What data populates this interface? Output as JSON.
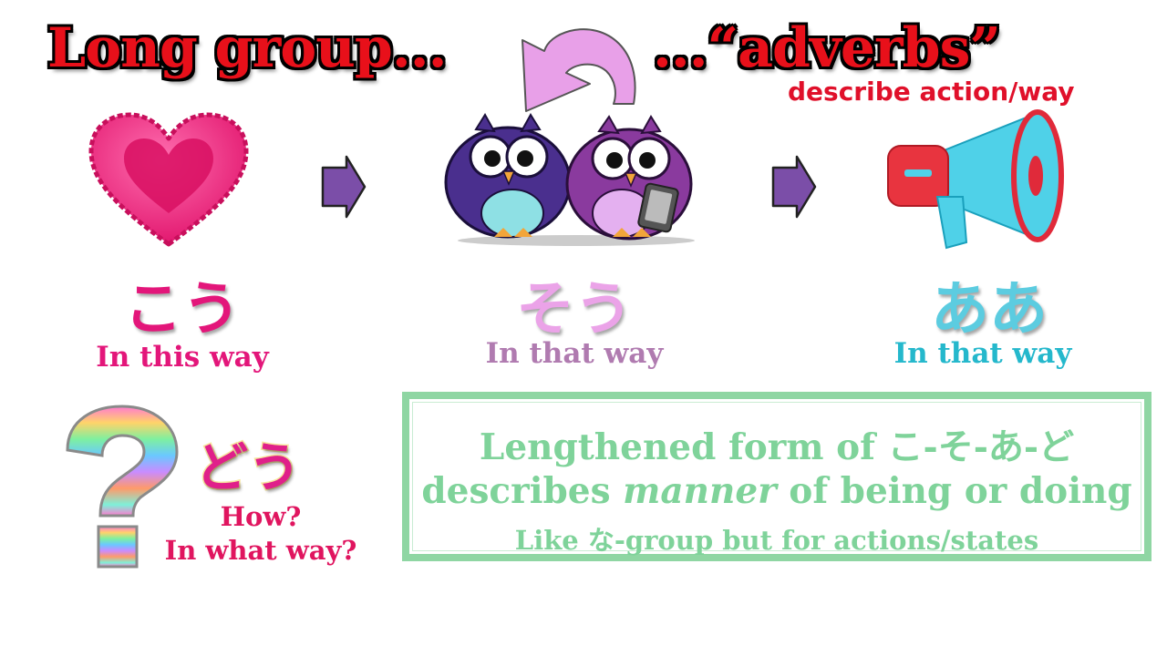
{
  "header": {
    "title_left": "Long group...",
    "title_right": "...“adverbs”",
    "subtitle": "describe action/way"
  },
  "items": [
    {
      "kana": "こう",
      "gloss": "In this way",
      "icon": "heart-icon",
      "color": "#e3167a"
    },
    {
      "kana": "そう",
      "gloss": "In that way",
      "icon": "owls-icon",
      "color": "#b07bb0",
      "kana_color": "#eba3e8"
    },
    {
      "kana": "ああ",
      "gloss": "In that way",
      "icon": "megaphone-icon",
      "color": "#25b8cc",
      "kana_color": "#5ccce0"
    }
  ],
  "question": {
    "kana": "どう",
    "line1": "How?",
    "line2": "In what way?",
    "icon": "question-mark-icon",
    "kana_color": "#e0208a"
  },
  "note": {
    "line1": "Lengthened form of こ-そ-あ-ど",
    "line2_pre": "describes ",
    "line2_em": "manner",
    "line2_post": " of being or doing",
    "line3": "Like な-group but for actions/states"
  },
  "colors": {
    "title_red": "#e8101a",
    "arrow_purple": "#7b4ea8",
    "curved_arrow": "#e8a0e8",
    "note_green": "#7fd39a"
  }
}
